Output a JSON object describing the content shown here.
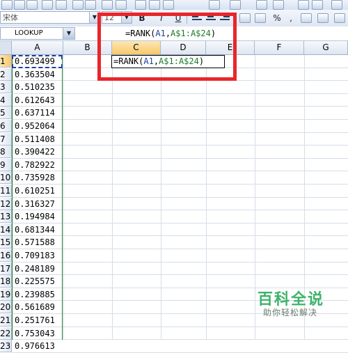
{
  "toolbar": {
    "font_name": "宋体",
    "font_size": "12",
    "bold_label": "B",
    "italic_label": "I",
    "underline_label": "U",
    "percent_label": "%",
    "comma_label": ","
  },
  "formula_bar": {
    "name_box": "LOOKUP",
    "formula_prefix": "=RANK(",
    "formula_ref1": "A1",
    "formula_sep": ",",
    "formula_ref2": "A$1:A$24",
    "formula_suffix": ")"
  },
  "columns": [
    "A",
    "B",
    "C",
    "D",
    "E",
    "F",
    "G"
  ],
  "rows": [
    "1",
    "2",
    "3",
    "4",
    "5",
    "6",
    "7",
    "8",
    "9",
    "10",
    "11",
    "12",
    "13",
    "14",
    "15",
    "16",
    "17",
    "18",
    "19",
    "20",
    "21",
    "22",
    "23"
  ],
  "column_a_values": [
    "0.693499",
    "0.363504",
    "0.510235",
    "0.612643",
    "0.637114",
    "0.952064",
    "0.511408",
    "0.390422",
    "0.782922",
    "0.735928",
    "0.610251",
    "0.316327",
    "0.194984",
    "0.681344",
    "0.571588",
    "0.709183",
    "0.248189",
    "0.225575",
    "0.239885",
    "0.561689",
    "0.251761",
    "0.753043",
    "0.976613"
  ],
  "edit_cell": {
    "prefix": "=RANK(",
    "ref1": "A1",
    "sep": ",",
    "ref2": "A$1:A$24",
    "suffix": ")"
  },
  "watermark": {
    "title": "百科全说",
    "subtitle": "助你轻松解决"
  },
  "colors": {
    "highlight": "#e8262b",
    "ref_blue": "#1d3f9e",
    "ref_green": "#1d7a2b",
    "watermark_green": "#3db36a"
  }
}
